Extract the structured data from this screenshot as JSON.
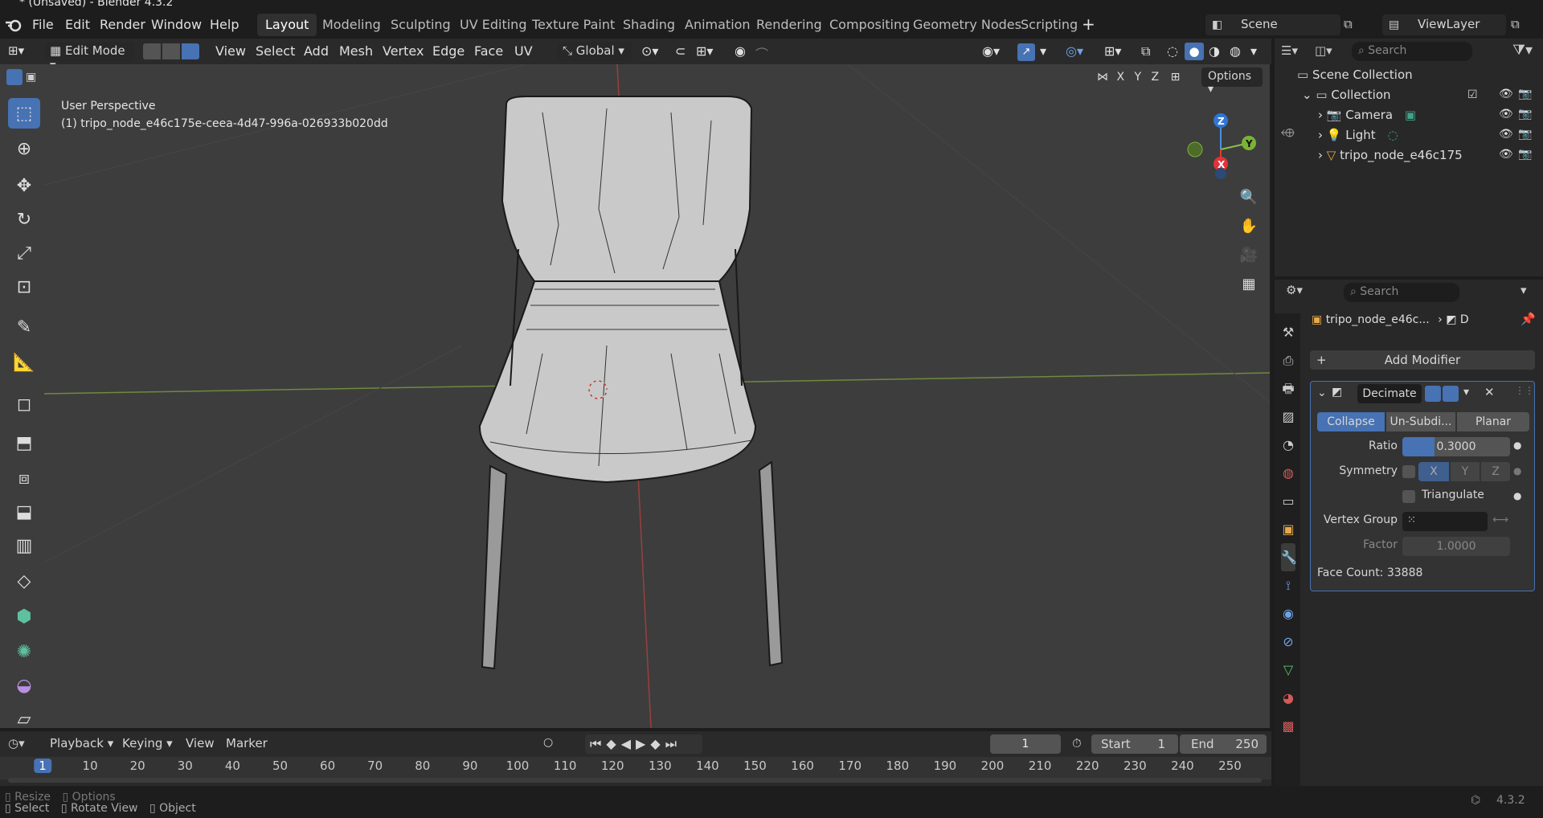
{
  "window_title": "* (Unsaved) - Blender 4.3.2",
  "menu": [
    "File",
    "Edit",
    "Render",
    "Window",
    "Help"
  ],
  "workspaces": [
    "Layout",
    "Modeling",
    "Sculpting",
    "UV Editing",
    "Texture Paint",
    "Shading",
    "Animation",
    "Rendering",
    "Compositing",
    "Geometry Nodes",
    "Scripting"
  ],
  "active_workspace": "Layout",
  "scene": "Scene",
  "view_layer": "ViewLayer",
  "viewport_header": {
    "mode": "Edit Mode",
    "menus": [
      "View",
      "Select",
      "Add",
      "Mesh",
      "Vertex",
      "Edge",
      "Face",
      "UV"
    ],
    "transform_orientation": "Global",
    "options_label": "Options",
    "axes": [
      "X",
      "Y",
      "Z"
    ]
  },
  "viewport_overlay": {
    "perspective": "User Perspective",
    "object": "(1) tripo_node_e46c175e-ceea-4d47-996a-026933b020dd"
  },
  "navigation_gizmo": {
    "z": "Z",
    "y": "Y",
    "x": "X"
  },
  "outliner": {
    "search_placeholder": "Search",
    "root": "Scene Collection",
    "collection": "Collection",
    "items": [
      {
        "name": "Camera",
        "icon": "camera-icon"
      },
      {
        "name": "Light",
        "icon": "light-icon"
      },
      {
        "name": "tripo_node_e46c175e",
        "icon": "mesh-icon"
      }
    ]
  },
  "properties": {
    "search_placeholder": "Search",
    "object_name": "tripo_node_e46c...",
    "data_label": "D",
    "add_modifier": "Add Modifier",
    "modifier": {
      "name": "Decimate",
      "modes": [
        "Collapse",
        "Un-Subdi...",
        "Planar"
      ],
      "active_mode": "Collapse",
      "ratio_label": "Ratio",
      "ratio": "0.3000",
      "ratio_fraction": 0.3,
      "symmetry_label": "Symmetry",
      "sym_axes": [
        "X",
        "Y",
        "Z"
      ],
      "triangulate_label": "Triangulate",
      "vertex_group_label": "Vertex Group",
      "factor_label": "Factor",
      "factor": "1.0000",
      "face_count": "Face Count: 33888"
    }
  },
  "timeline": {
    "menus": [
      "Playback",
      "Keying",
      "View",
      "Marker"
    ],
    "current_frame": "1",
    "start_label": "Start",
    "start": "1",
    "end_label": "End",
    "end": "250",
    "ticks": [
      "1",
      "10",
      "20",
      "30",
      "40",
      "50",
      "60",
      "70",
      "80",
      "90",
      "100",
      "110",
      "120",
      "130",
      "140",
      "150",
      "160",
      "170",
      "180",
      "190",
      "200",
      "210",
      "220",
      "230",
      "240",
      "250"
    ]
  },
  "status": {
    "items": [
      "Select",
      "Rotate View",
      "Object"
    ],
    "overlay_items": [
      "Resize",
      "Options"
    ],
    "version": "4.3.2"
  }
}
